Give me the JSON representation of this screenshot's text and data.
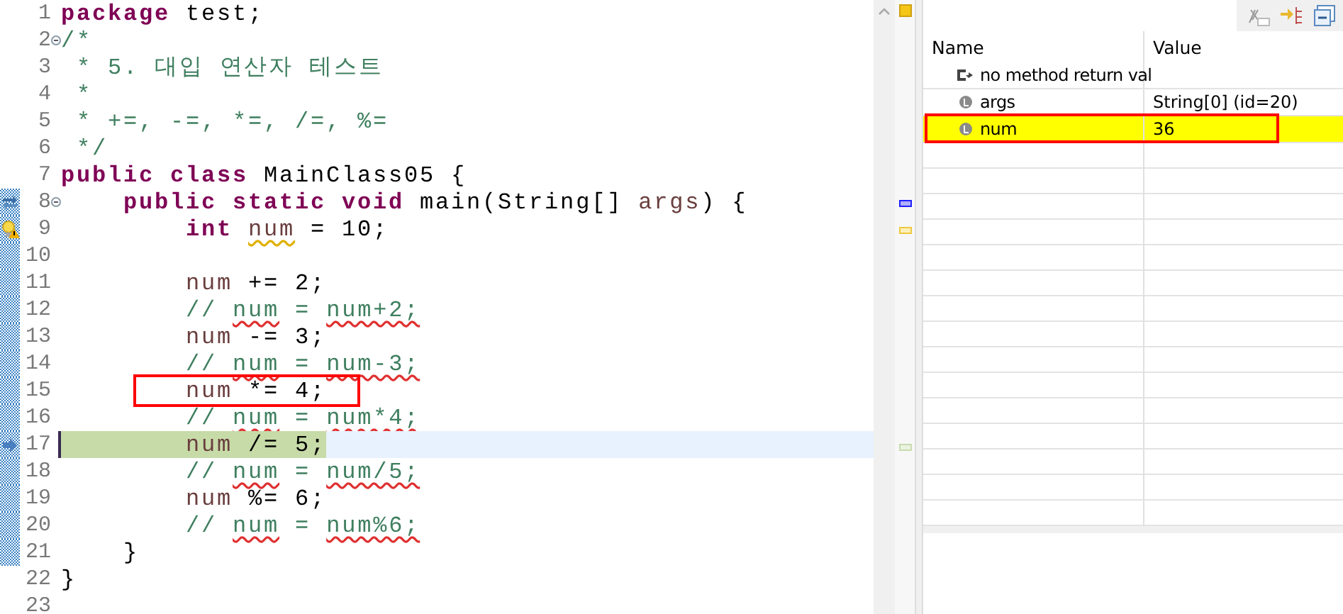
{
  "editor": {
    "lines": [
      {
        "number": "1",
        "tokens": [
          {
            "kind": "keyword",
            "text": "package"
          },
          {
            "kind": "plain",
            "text": " test;"
          }
        ]
      },
      {
        "number": "2",
        "folding": true,
        "tokens": [
          {
            "kind": "comment",
            "text": "/*"
          }
        ]
      },
      {
        "number": "3",
        "tokens": [
          {
            "kind": "comment",
            "text": " * 5. 대입 연산자 테스트"
          }
        ]
      },
      {
        "number": "4",
        "tokens": [
          {
            "kind": "comment",
            "text": " *"
          }
        ]
      },
      {
        "number": "5",
        "tokens": [
          {
            "kind": "comment",
            "text": " * +=, -=, *=, /=, %="
          }
        ]
      },
      {
        "number": "6",
        "tokens": [
          {
            "kind": "comment",
            "text": " */"
          }
        ]
      },
      {
        "number": "7",
        "tokens": [
          {
            "kind": "keyword",
            "text": "public class"
          },
          {
            "kind": "plain",
            "text": " MainClass05 {"
          }
        ]
      },
      {
        "number": "8",
        "folding": true,
        "range": true,
        "step_marker": true,
        "tokens": [
          {
            "kind": "keyword",
            "text": "    public static void"
          },
          {
            "kind": "plain",
            "text": " main(String[] "
          },
          {
            "kind": "variable",
            "text": "args"
          },
          {
            "kind": "plain",
            "text": ") {"
          }
        ]
      },
      {
        "number": "9",
        "range": true,
        "warning_marker": true,
        "tokens": [
          {
            "kind": "keyword",
            "text": "        int "
          },
          {
            "kind": "variable",
            "text": "num",
            "warning": true
          },
          {
            "kind": "plain",
            "text": " = 10;"
          }
        ]
      },
      {
        "number": "10",
        "range": true
      },
      {
        "number": "11",
        "range": true,
        "tokens": [
          {
            "kind": "variable",
            "text": "        num"
          },
          {
            "kind": "plain",
            "text": " += 2;"
          }
        ]
      },
      {
        "number": "12",
        "range": true,
        "tokens": [
          {
            "kind": "comment",
            "text": "        // "
          },
          {
            "kind": "comment",
            "text": "num",
            "misspelled": true
          },
          {
            "kind": "comment",
            "text": " = "
          },
          {
            "kind": "comment",
            "text": "num+2;",
            "misspelled": true
          }
        ]
      },
      {
        "number": "13",
        "range": true,
        "tokens": [
          {
            "kind": "variable",
            "text": "        num"
          },
          {
            "kind": "plain",
            "text": " -= 3;"
          }
        ]
      },
      {
        "number": "14",
        "range": true,
        "tokens": [
          {
            "kind": "comment",
            "text": "        // "
          },
          {
            "kind": "comment",
            "text": "num",
            "misspelled": true
          },
          {
            "kind": "comment",
            "text": " = "
          },
          {
            "kind": "comment",
            "text": "num-3;",
            "misspelled": true
          }
        ]
      },
      {
        "number": "15",
        "range": true,
        "boxed": true,
        "tokens": [
          {
            "kind": "variable",
            "text": "        num"
          },
          {
            "kind": "plain",
            "text": " *= 4;"
          }
        ]
      },
      {
        "number": "16",
        "range": true,
        "tokens": [
          {
            "kind": "comment",
            "text": "        // "
          },
          {
            "kind": "comment",
            "text": "num",
            "misspelled": true
          },
          {
            "kind": "comment",
            "text": " = "
          },
          {
            "kind": "comment",
            "text": "num*4;",
            "misspelled": true
          }
        ]
      },
      {
        "number": "17",
        "range": true,
        "current": true,
        "tokens": [
          {
            "kind": "variable",
            "text": "        num"
          },
          {
            "kind": "plain",
            "text": " /= 5;"
          }
        ]
      },
      {
        "number": "18",
        "range": true,
        "tokens": [
          {
            "kind": "comment",
            "text": "        // "
          },
          {
            "kind": "comment",
            "text": "num",
            "misspelled": true
          },
          {
            "kind": "comment",
            "text": " = "
          },
          {
            "kind": "comment",
            "text": "num/5;",
            "misspelled": true
          }
        ]
      },
      {
        "number": "19",
        "range": true,
        "tokens": [
          {
            "kind": "variable",
            "text": "        num"
          },
          {
            "kind": "plain",
            "text": " %= 6;"
          }
        ]
      },
      {
        "number": "20",
        "range": true,
        "tokens": [
          {
            "kind": "comment",
            "text": "        // "
          },
          {
            "kind": "comment",
            "text": "num",
            "misspelled": true
          },
          {
            "kind": "comment",
            "text": " = "
          },
          {
            "kind": "comment",
            "text": "num%6;",
            "misspelled": true
          }
        ]
      },
      {
        "number": "21",
        "range": true,
        "tokens": [
          {
            "kind": "plain",
            "text": "    }"
          }
        ]
      },
      {
        "number": "22",
        "tokens": [
          {
            "kind": "plain",
            "text": "}"
          }
        ]
      },
      {
        "number": "23"
      }
    ]
  },
  "variables": {
    "columns": [
      "Name",
      "Value"
    ],
    "rows": [
      {
        "kind": "return",
        "name": "no method return val",
        "selected": false,
        "boxed": false
      },
      {
        "kind": "local",
        "name": "args",
        "value": "String[0]  (id=20)",
        "selected": false,
        "boxed": false
      },
      {
        "kind": "local",
        "name": "num",
        "value": "36",
        "selected": true,
        "boxed": true
      }
    ]
  }
}
